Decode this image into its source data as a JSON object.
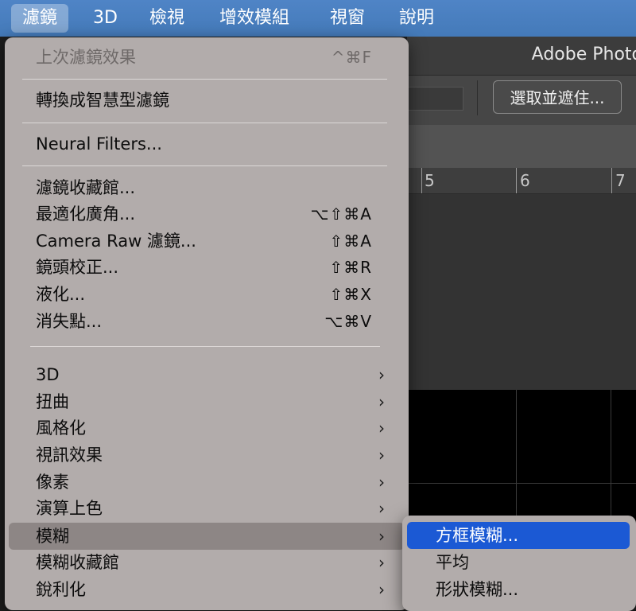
{
  "menubar": {
    "items": [
      "濾鏡",
      "3D",
      "檢視",
      "增效模組",
      "視窗",
      "說明"
    ],
    "active": "濾鏡"
  },
  "app": {
    "title": "Adobe Photo",
    "select_mask_button": "選取並遮住...",
    "ruler_labels": [
      "5",
      "6",
      "7"
    ]
  },
  "filter_menu": {
    "last_filter": {
      "label": "上次濾鏡效果",
      "shortcut": "^⌘F"
    },
    "smart_filter": {
      "label": "轉換成智慧型濾鏡"
    },
    "neural": {
      "label": "Neural Filters..."
    },
    "gallery": {
      "label": "濾鏡收藏館..."
    },
    "adaptive_wide": {
      "label": "最適化廣角...",
      "shortcut": "⌥⇧⌘A"
    },
    "camera_raw": {
      "label": "Camera Raw 濾鏡...",
      "shortcut": "⇧⌘A"
    },
    "lens_correction": {
      "label": "鏡頭校正...",
      "shortcut": "⇧⌘R"
    },
    "liquify": {
      "label": "液化...",
      "shortcut": "⇧⌘X"
    },
    "vanishing_point": {
      "label": "消失點...",
      "shortcut": "⌥⌘V"
    },
    "submenus": [
      "3D",
      "扭曲",
      "風格化",
      "視訊效果",
      "像素",
      "演算上色",
      "模糊",
      "模糊收藏館",
      "銳利化"
    ],
    "highlighted": "模糊",
    "chevron": "›"
  },
  "blur_submenu": {
    "items": [
      "方框模糊...",
      "平均",
      "形狀模糊..."
    ],
    "selected": "方框模糊..."
  },
  "colors": {
    "menubar": "#4a7fc0",
    "menu_bg": "#b2acab",
    "highlight": "#8d8685",
    "selection": "#1b59d4"
  }
}
